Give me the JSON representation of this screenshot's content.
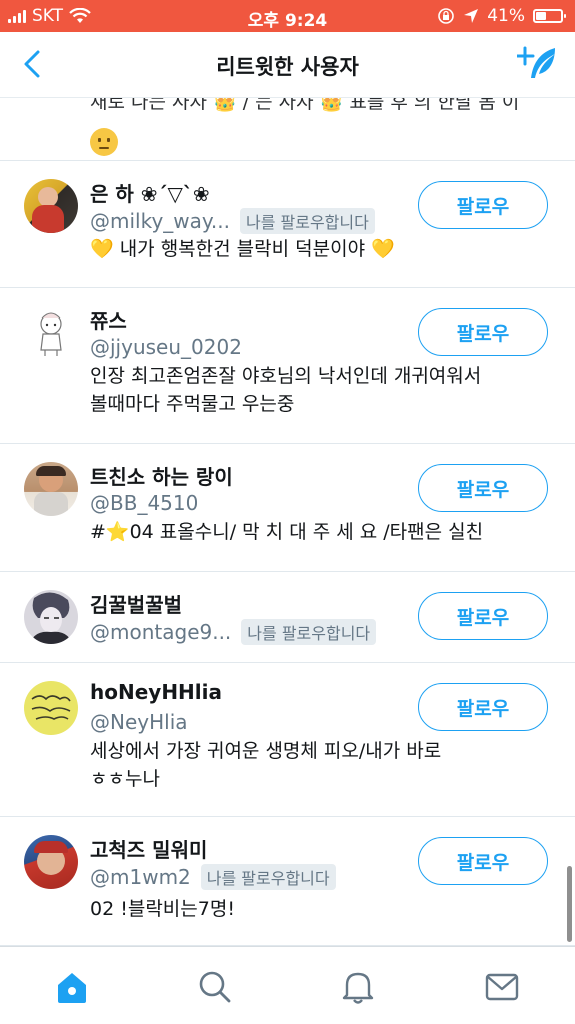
{
  "status_bar": {
    "carrier": "SKT",
    "time": "오후 9:24",
    "battery": "41%",
    "battery_level": 0.41
  },
  "header": {
    "title": "리트윗한 사용자"
  },
  "partial_item": {
    "bio_fragment": "새로 나는 사자 👑 / 는 사자 👑 표를 후 의 한달 봄 이"
  },
  "users": [
    {
      "name": "은 하 ❀´▽`❀",
      "handle": "@milky_way...",
      "follows_you": "나를 팔로우합니다",
      "bio": "💛 내가 행복한건 블락비 덕분이야 💛",
      "follow_label": "팔로우"
    },
    {
      "name": "쮸스",
      "handle": "@jjyuseu_0202",
      "bio_line1": "인장 최고존엄존잘 야호님의 낙서인데 개귀여워서",
      "bio_line2": "볼때마다 주먹물고 우는중",
      "follow_label": "팔로우"
    },
    {
      "name": "트친소 하는 랑이",
      "handle": "@BB_4510",
      "bio": "#⭐04 표올수니/ 막 치 대 주 세 요 /타팬은 실친",
      "follow_label": "팔로우"
    },
    {
      "name": "김꿀벌꿀벌",
      "handle": "@montage9...",
      "follows_you": "나를 팔로우합니다",
      "follow_label": "팔로우"
    },
    {
      "name": "hoNeyHHlia",
      "handle": "@NeyHlia",
      "bio_line1": "세상에서 가장 귀여운 생명체 피오/내가 바로",
      "bio_line2": "ㅎㅎ누나",
      "follow_label": "팔로우"
    },
    {
      "name": "고척즈 밀워미",
      "handle": "@m1wm2",
      "follows_you": "나를 팔로우합니다",
      "bio": "02 !블락비는7명!",
      "follow_label": "팔로우"
    }
  ],
  "tabbar": {
    "icons": [
      "home-icon",
      "search-icon",
      "notifications-icon",
      "messages-icon"
    ]
  },
  "colors": {
    "status_bar": "#f0573f",
    "accent": "#1da1f2",
    "secondary_text": "#657786"
  }
}
